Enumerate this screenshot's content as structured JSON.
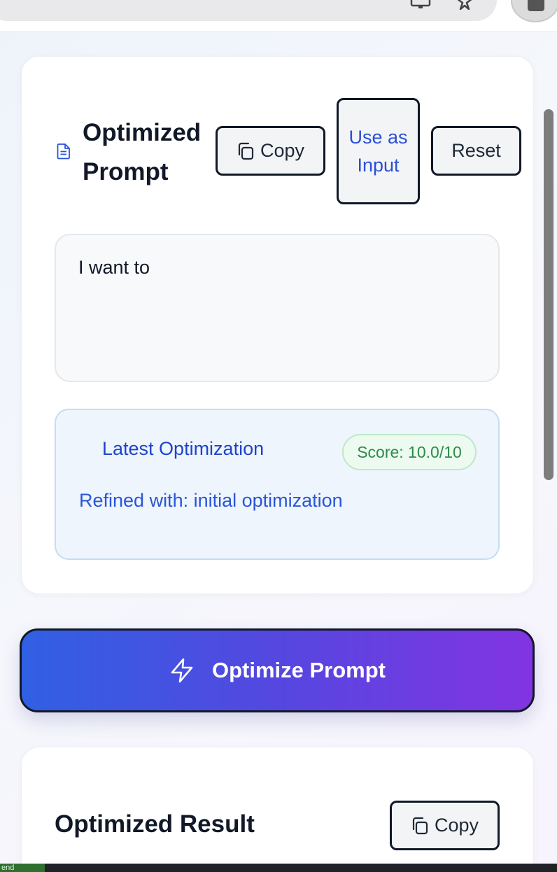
{
  "optimized_prompt": {
    "title": "Optimized Prompt",
    "copy_label": "Copy",
    "use_as_input_label": "Use as Input",
    "reset_label": "Reset",
    "prompt_text": "I want to"
  },
  "latest_optimization": {
    "title": "Latest Optimization",
    "score": "Score: 10.0/10",
    "refined_with": "Refined with: initial optimization"
  },
  "optimize_button": {
    "label": "Optimize Prompt"
  },
  "optimized_result": {
    "title": "Optimized Result",
    "copy_label": "Copy"
  },
  "status_bar": {
    "tag": "end"
  },
  "colors": {
    "accent_blue": "#2a4fd6",
    "score_green": "#2e8a4c",
    "gradient_start": "#3060e3",
    "gradient_end": "#8234e2"
  },
  "icons": [
    "monitor-icon",
    "star-icon",
    "profile-icon",
    "document-icon",
    "copy-icon",
    "lightning-icon"
  ]
}
